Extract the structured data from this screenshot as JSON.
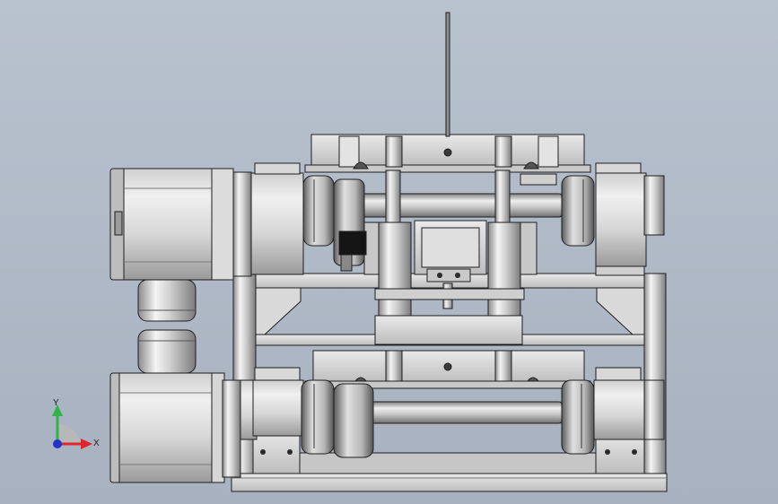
{
  "viewport": {
    "background_top": "#b9c2cf",
    "background_bottom": "#a7b1bf"
  },
  "model": {
    "metal_light": "#e6e6e6",
    "metal_mid": "#c9c9c9",
    "metal_dark": "#8e8e8e",
    "edge": "#1e1e1e",
    "black_part": "#151515"
  },
  "triad": {
    "x_label": "X",
    "y_label": "Y",
    "x_color": "#e0262b",
    "y_color": "#2fb34a",
    "z_color": "#2233cc"
  }
}
